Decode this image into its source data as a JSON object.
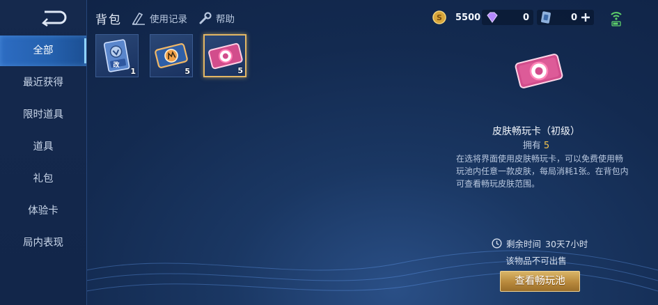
{
  "sidebar": {
    "items": [
      {
        "label": "全部"
      },
      {
        "label": "最近获得"
      },
      {
        "label": "限时道具"
      },
      {
        "label": "道具"
      },
      {
        "label": "礼包"
      },
      {
        "label": "体验卡"
      },
      {
        "label": "局内表现"
      }
    ]
  },
  "header": {
    "title": "背包",
    "usage_log": "使用记录",
    "help": "帮助"
  },
  "currencies": {
    "gold": "5500",
    "diamond": "0",
    "voucher": "0"
  },
  "inventory": {
    "items": [
      {
        "name": "rename-card",
        "badge": "改",
        "qty": "1"
      },
      {
        "name": "skin-trial-card",
        "qty": "5"
      },
      {
        "name": "skin-pass-card-basic",
        "qty": "5"
      }
    ]
  },
  "detail": {
    "name": "皮肤畅玩卡（初级）",
    "owned_label": "拥有",
    "owned_count": "5",
    "description": "在选将界面使用皮肤畅玩卡，可以免费使用畅玩池内任意一款皮肤，每局消耗1张。在背包内可查看畅玩皮肤范围。",
    "remaining_label": "剩余时间",
    "remaining_value": "30天7小时",
    "not_sellable": "该物品不可出售",
    "view_button": "查看畅玩池"
  },
  "colors": {
    "accent_gold": "#f3c44f",
    "active_tab": "#2d6cc2",
    "button_gold": "#c99a48"
  }
}
